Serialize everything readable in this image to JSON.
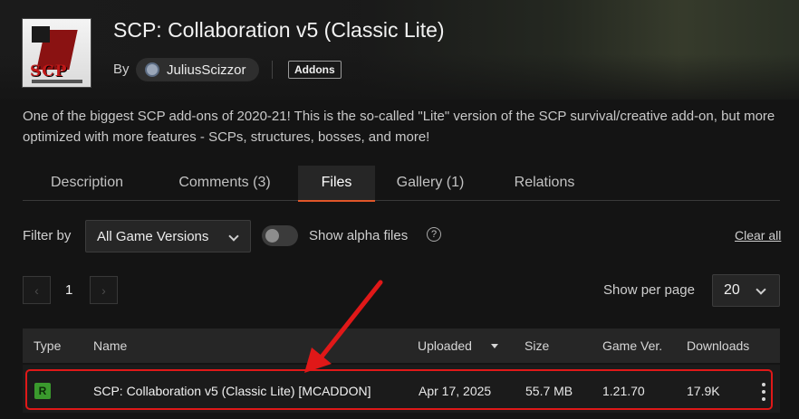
{
  "project": {
    "title": "SCP: Collaboration v5 (Classic Lite)",
    "by_label": "By",
    "author": "JuliusScizzor",
    "category_tag": "Addons",
    "thumbnail_text": "SCP",
    "summary": "One of the biggest SCP add-ons of 2020-21! This is the so-called \"Lite\" version of the SCP survival/creative add-on, but more optimized with more features - SCPs, structures, bosses, and more!"
  },
  "tabs": [
    {
      "label": "Description",
      "active": false
    },
    {
      "label": "Comments (3)",
      "active": false
    },
    {
      "label": "Files",
      "active": true
    },
    {
      "label": "Gallery (1)",
      "active": false
    },
    {
      "label": "Relations",
      "active": false
    }
  ],
  "filters": {
    "filter_by_label": "Filter by",
    "game_version_value": "All Game Versions",
    "alpha_toggle_label": "Show alpha files",
    "alpha_toggle_on": false,
    "help_glyph": "?",
    "clear_all_label": "Clear all"
  },
  "pagination": {
    "prev_glyph": "‹",
    "current_page": "1",
    "next_glyph": "›",
    "per_page_label": "Show per page",
    "per_page_value": "20"
  },
  "table": {
    "columns": [
      "Type",
      "Name",
      "Uploaded",
      "Size",
      "Game Ver.",
      "Downloads"
    ],
    "sorted_column": "Uploaded",
    "rows": [
      {
        "type": "R",
        "name": "SCP: Collaboration v5 (Classic Lite) [MCADDON]",
        "uploaded": "Apr 17, 2025",
        "size": "55.7 MB",
        "game_version": "1.21.70",
        "downloads": "17.9K"
      }
    ]
  },
  "colors": {
    "accent": "#e0562a",
    "release_badge": "#3a9a2d",
    "annotation": "#e01818",
    "background": "#141414"
  }
}
